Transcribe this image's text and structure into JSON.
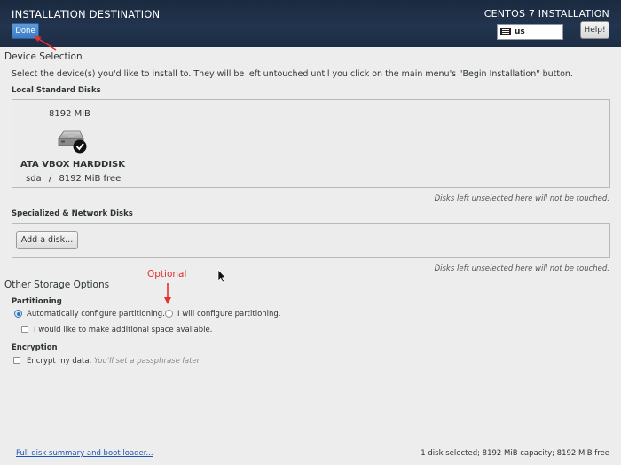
{
  "header": {
    "title": "INSTALLATION DESTINATION",
    "done_label": "Done",
    "product": "CENTOS 7 INSTALLATION",
    "keyboard_layout": "us",
    "help_label": "Help!"
  },
  "device_selection": {
    "title": "Device Selection",
    "description": "Select the device(s) you'd like to install to.  They will be left untouched until you click on the main menu's \"Begin Installation\" button.",
    "local_disks": {
      "title": "Local Standard Disks",
      "disks": [
        {
          "size": "8192 MiB",
          "name": "ATA VBOX HARDDISK",
          "dev": "sda",
          "separator": "/",
          "free": "8192 MiB free",
          "selected": true
        }
      ],
      "note": "Disks left unselected here will not be touched."
    },
    "network_disks": {
      "title": "Specialized & Network Disks",
      "add_label": "Add a disk...",
      "note": "Disks left unselected here will not be touched."
    }
  },
  "storage_options": {
    "title": "Other Storage Options",
    "annotation": "Optional",
    "partitioning": {
      "title": "Partitioning",
      "auto_label": "Automatically configure partitioning.",
      "manual_label": "I will configure partitioning.",
      "selected": "auto",
      "extra_space_label": "I would like to make additional space available.",
      "extra_space_checked": false
    },
    "encryption": {
      "title": "Encryption",
      "encrypt_label": "Encrypt my data.",
      "encrypt_hint": "You'll set a passphrase later.",
      "encrypt_checked": false
    }
  },
  "footer": {
    "summary_link": "Full disk summary and boot loader...",
    "status": "1 disk selected; 8192 MiB capacity; 8192 MiB free"
  },
  "colors": {
    "header_bg": "#1d2d44",
    "done_button": "#3d7dc6",
    "annotation_red": "#e53030",
    "link": "#1e55b3"
  }
}
